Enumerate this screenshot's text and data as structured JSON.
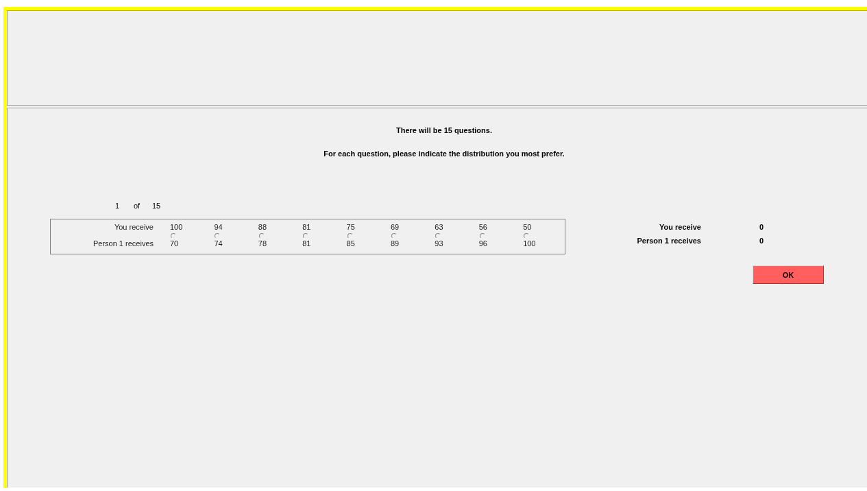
{
  "instructions": [
    "There will be 15 questions.",
    "For each question, please indicate the distribution you most prefer."
  ],
  "progress": {
    "current": "1",
    "separator": "of",
    "total": "15"
  },
  "choice_table": {
    "you_label": "You receive",
    "other_label": "Person 1 receives",
    "options": [
      {
        "you": "100",
        "other": "70",
        "selected": false
      },
      {
        "you": "94",
        "other": "74",
        "selected": false
      },
      {
        "you": "88",
        "other": "78",
        "selected": false
      },
      {
        "you": "81",
        "other": "81",
        "selected": false
      },
      {
        "you": "75",
        "other": "85",
        "selected": false
      },
      {
        "you": "69",
        "other": "89",
        "selected": false
      },
      {
        "you": "63",
        "other": "93",
        "selected": false
      },
      {
        "you": "56",
        "other": "96",
        "selected": false
      },
      {
        "you": "50",
        "other": "100",
        "selected": false
      }
    ]
  },
  "summary": [
    {
      "label": "You receive",
      "value": "0"
    },
    {
      "label": "Person 1 receives",
      "value": "0"
    }
  ],
  "ok_button": "OK"
}
